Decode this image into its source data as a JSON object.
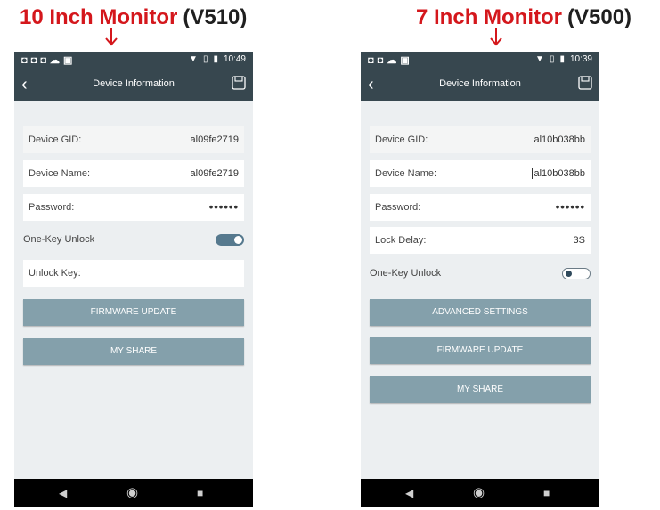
{
  "left": {
    "caption_size": "10 Inch Monitor",
    "caption_model": "(V510)",
    "status_time": "10:49",
    "title": "Device Information",
    "gid_label": "Device GID:",
    "gid_value": "al09fe2719",
    "name_label": "Device Name:",
    "name_value": "al09fe2719",
    "password_label": "Password:",
    "password_value": "••••••",
    "onekey_label": "One-Key Unlock",
    "onekey_state": "on",
    "unlockkey_label": "Unlock Key:",
    "firmware_label": "FIRMWARE UPDATE",
    "share_label": "MY SHARE"
  },
  "right": {
    "caption_size": "7 Inch Monitor",
    "caption_model": "(V500)",
    "status_time": "10:39",
    "title": "Device Information",
    "gid_label": "Device GID:",
    "gid_value": "al10b038bb",
    "name_label": "Device Name:",
    "name_value": "al10b038bb",
    "password_label": "Password:",
    "password_value": "••••••",
    "lockdelay_label": "Lock Delay:",
    "lockdelay_value": "3S",
    "onekey_label": "One-Key Unlock",
    "onekey_state": "off",
    "advanced_label": "ADVANCED SETTINGS",
    "firmware_label": "FIRMWARE UPDATE",
    "share_label": "MY SHARE"
  },
  "colors": {
    "caption_red": "#d4171c",
    "appbar": "#37474f",
    "button": "#84a0ab",
    "toggle_on": "#56798e",
    "screen_bg": "#eceff1"
  },
  "icons": [
    "back-arrow-icon",
    "save-icon",
    "wifi-icon",
    "sim-icon",
    "battery-icon",
    "nav-back-icon",
    "nav-home-icon",
    "nav-recents-icon"
  ]
}
